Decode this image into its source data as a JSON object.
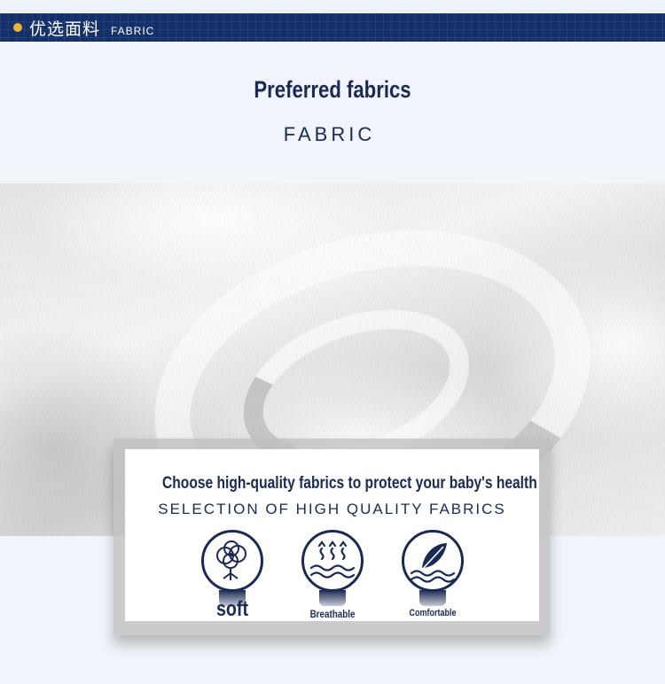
{
  "header": {
    "cn_title": "优选面料",
    "en_title": "FABRIC"
  },
  "section": {
    "title": "Preferred fabrics",
    "subtitle": "FABRIC"
  },
  "card": {
    "headline": "Choose high-quality fabrics to protect your baby's health",
    "subheadline": "SELECTION OF HIGH QUALITY FABRICS",
    "features": [
      {
        "label": "soft",
        "icon": "cotton-icon"
      },
      {
        "label": "Breathable",
        "icon": "breathable-waves-icon"
      },
      {
        "label": "Comfortable",
        "icon": "feather-icon"
      }
    ]
  },
  "colors": {
    "navy": "#1b2a55",
    "header_bg": "#13306b",
    "accent_dot": "#f2b233",
    "page_bg": "#f1f4fb"
  }
}
